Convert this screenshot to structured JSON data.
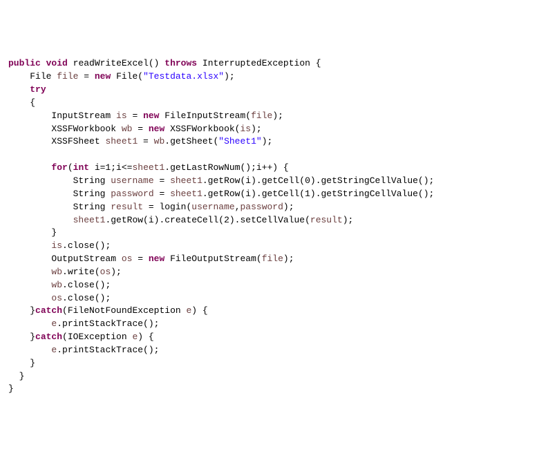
{
  "code": {
    "line1": {
      "kw_public": "public",
      "kw_void": "void",
      "method_decl": "readWriteExcel",
      "paren_throws": "() ",
      "kw_throws": "throws",
      "space": " ",
      "exc": "InterruptedException {"
    },
    "line2": {
      "indent": "    ",
      "type": "File ",
      "var": "file",
      "eq": " = ",
      "kw_new": "new",
      "post": " File(",
      "str": "\"Testdata.xlsx\"",
      "end": ");"
    },
    "line3": {
      "indent": "    ",
      "kw_try": "try"
    },
    "line4": {
      "indent": "    ",
      "brace": "{"
    },
    "line5": {
      "indent": "        ",
      "type": "InputStream ",
      "var": "is",
      "eq": " = ",
      "kw_new": "new",
      "post": " FileInputStream(",
      "arg": "file",
      "end": ");"
    },
    "line6": {
      "indent": "        ",
      "type": "XSSFWorkbook ",
      "var": "wb",
      "eq": " = ",
      "kw_new": "new",
      "post": " XSSFWorkbook(",
      "arg": "is",
      "end": ");"
    },
    "line7": {
      "indent": "        ",
      "type": "XSSFSheet ",
      "var": "sheet1",
      "eq": " = ",
      "call_obj": "wb",
      "call": ".getSheet(",
      "str": "\"Sheet1\"",
      "end": ");"
    },
    "blank1": "",
    "line8": {
      "indent": "        ",
      "kw_for": "for",
      "open": "(",
      "kw_int": "int",
      "init": " i=1;i<=",
      "obj": "sheet1",
      "call": ".getLastRowNum();i++) {"
    },
    "line9": {
      "indent": "            ",
      "type": "String ",
      "var": "username",
      "eq": " = ",
      "obj": "sheet1",
      "rest": ".getRow(i).getCell(0).getStringCellValue();"
    },
    "line10": {
      "indent": "            ",
      "type": "String ",
      "var": "password",
      "eq": " = ",
      "obj": "sheet1",
      "rest": ".getRow(i).getCell(1).getStringCellValue();"
    },
    "line11": {
      "indent": "            ",
      "type": "String ",
      "var": "result",
      "eq": " = login(",
      "arg1": "username",
      "comma": ",",
      "arg2": "password",
      "end": ");"
    },
    "line12": {
      "indent": "            ",
      "obj": "sheet1",
      "rest1": ".getRow(i).createCell(2).setCellValue(",
      "arg": "result",
      "end": ");"
    },
    "line13": {
      "indent": "        ",
      "brace": "}"
    },
    "line14": {
      "indent": "        ",
      "obj": "is",
      "rest": ".close();"
    },
    "line15": {
      "indent": "        ",
      "type": "OutputStream ",
      "var": "os",
      "eq": " = ",
      "kw_new": "new",
      "post": " FileOutputStream(",
      "arg": "file",
      "end": ");"
    },
    "line16": {
      "indent": "        ",
      "obj": "wb",
      "rest": ".write(",
      "arg": "os",
      "end": ");"
    },
    "line17": {
      "indent": "        ",
      "obj": "wb",
      "rest": ".close();"
    },
    "line18": {
      "indent": "        ",
      "obj": "os",
      "rest": ".close();"
    },
    "line19": {
      "indent": "    ",
      "brace": "}",
      "kw_catch": "catch",
      "open": "(FileNotFoundException ",
      "var": "e",
      "close": ") {"
    },
    "line20": {
      "indent": "        ",
      "obj": "e",
      "rest": ".printStackTrace();"
    },
    "line21": {
      "indent": "    ",
      "brace": "}",
      "kw_catch": "catch",
      "open": "(IOException ",
      "var": "e",
      "close": ") {"
    },
    "line22": {
      "indent": "        ",
      "obj": "e",
      "rest": ".printStackTrace();"
    },
    "line23": {
      "indent": "    ",
      "brace": "}"
    },
    "line24": {
      "indent": "  ",
      "brace": "}"
    },
    "line25": {
      "indent": "",
      "brace": "}"
    }
  }
}
